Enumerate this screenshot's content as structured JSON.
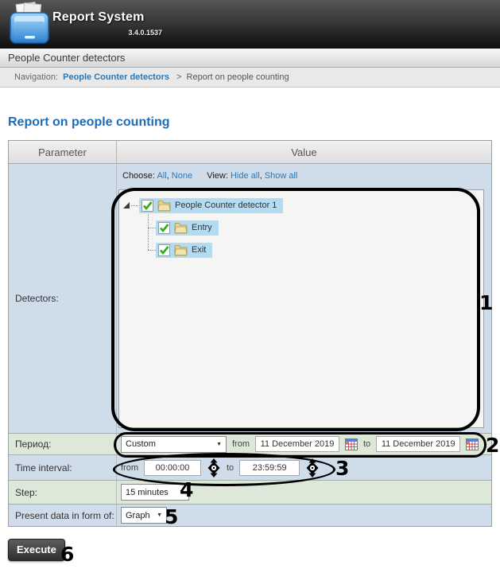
{
  "header": {
    "title": "Report System",
    "version": "3.4.0.1537"
  },
  "section_bar": {
    "title": "People Counter detectors"
  },
  "breadcrumb": {
    "label": "Navigation:",
    "link": "People Counter detectors",
    "separator": ">",
    "current": "Report on people counting"
  },
  "page_title": "Report on people counting",
  "table": {
    "header": {
      "parameter": "Parameter",
      "value": "Value"
    },
    "detectors": {
      "label": "Detectors:",
      "choose_label": "Choose:",
      "all_link": "All",
      "none_link": "None",
      "view_label": "View:",
      "hide_all_link": "Hide all",
      "show_all_link": "Show all",
      "comma": ",",
      "tree": {
        "root_label": "People Counter detector 1",
        "children": [
          {
            "label": "Entry"
          },
          {
            "label": "Exit"
          }
        ]
      }
    },
    "period": {
      "label": "Период:",
      "preset": "Custom",
      "from_label": "from",
      "from_value": "11 December 2019",
      "to_label": "to",
      "to_value": "11 December 2019"
    },
    "time_interval": {
      "label": "Time interval:",
      "from_label": "from",
      "from_value": "00:00:00",
      "to_label": "to",
      "to_value": "23:59:59"
    },
    "step": {
      "label": "Step:",
      "value": "15 minutes"
    },
    "present": {
      "label": "Present data in form of:",
      "value": "Graph"
    }
  },
  "execute_label": "Execute",
  "icons": {
    "dropdown_arrow": "▼"
  },
  "annotations": [
    "1",
    "2",
    "3",
    "4",
    "5",
    "6"
  ],
  "colors": {
    "accent_blue": "#1b6cb8",
    "link_blue": "#2878b8",
    "row_blue": "#cfdce9",
    "row_green": "#dde8d8",
    "tree_highlight": "#b3dcf2",
    "annotation_black": "#000000"
  }
}
